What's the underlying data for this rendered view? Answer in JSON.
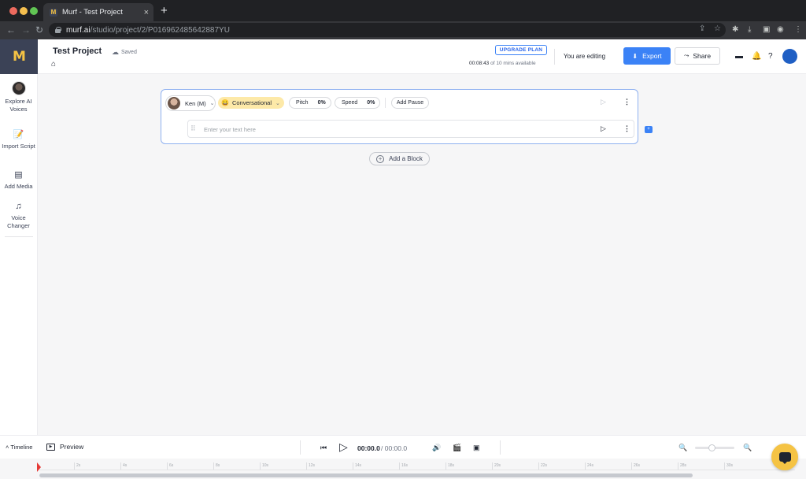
{
  "browser": {
    "tab_title": "Murf - Test Project",
    "tab_close": "×",
    "new_tab": "+",
    "back": "←",
    "forward": "→",
    "reload": "↻",
    "url_domain": "murf.ai",
    "url_path": "/studio/project/2/P016962485642887YU"
  },
  "app": {
    "logo_mark": "M",
    "project_title": "Test Project",
    "save_status": "Saved",
    "upgrade_label": "UPGRADE PLAN",
    "time_used": "00:08:43",
    "time_rest": "of 10 mins available",
    "editing_status": "You are editing",
    "export_label": "Export",
    "share_label": "Share",
    "accent_color": "#3b82f6",
    "brand_color": "#3b4256"
  },
  "sidebar": {
    "items": [
      {
        "label": "Explore AI Voices",
        "icon": "voice-avatar"
      },
      {
        "label": "Import Script",
        "icon": "import-icon"
      },
      {
        "label": "Add Media",
        "icon": "media-icon"
      },
      {
        "label": "Voice Changer",
        "icon": "voice-changer-icon"
      }
    ]
  },
  "block": {
    "voice_name": "Ken (M)",
    "style_label": "Conversational",
    "style_emoji": "😀",
    "pitch_label": "Pitch",
    "pitch_value": "0%",
    "speed_label": "Speed",
    "speed_value": "0%",
    "pause_label": "Add Pause",
    "text_placeholder": "Enter your text here",
    "text_value": ""
  },
  "add_block_label": "Add a Block",
  "bottom": {
    "timeline_label": "Timeline",
    "preview_label": "Preview",
    "current_time": "00:00.0",
    "total_time": "/ 00:00.0"
  },
  "timeline": {
    "ticks": [
      "2s",
      "4s",
      "6s",
      "8s",
      "10s",
      "12s",
      "14s",
      "16s",
      "18s",
      "20s",
      "22s",
      "24s",
      "26s",
      "28s",
      "30s"
    ]
  }
}
